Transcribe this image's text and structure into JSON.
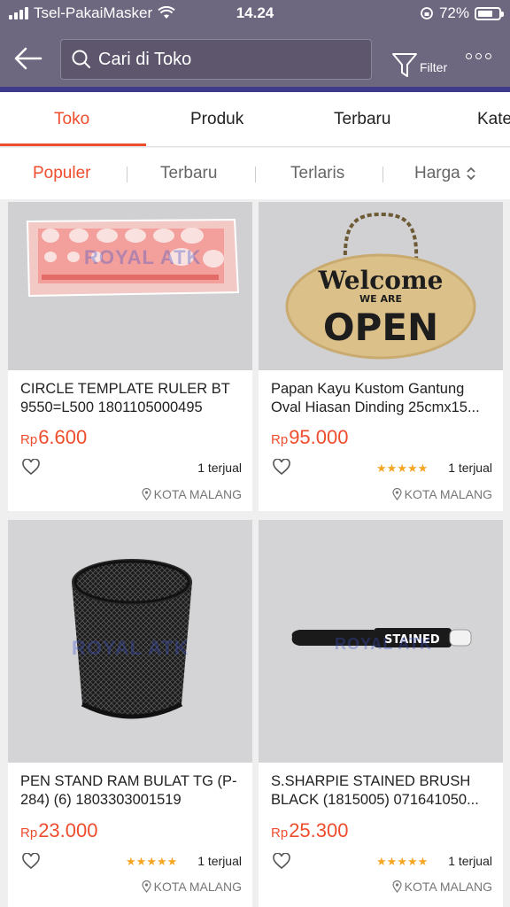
{
  "status": {
    "carrier": "Tsel-PakaiMasker",
    "time": "14.24",
    "battery": "72%",
    "battery_level": 0.72
  },
  "header": {
    "search_placeholder": "Cari di Toko",
    "filter_label": "Filter"
  },
  "tabs": [
    "Toko",
    "Produk",
    "Terbaru",
    "Kate"
  ],
  "sort": [
    "Populer",
    "Terbaru",
    "Terlaris",
    "Harga"
  ],
  "products": [
    {
      "name": "CIRCLE TEMPLATE RULER BT 9550=L500 1801105000495",
      "currency": "Rp",
      "price": "6.600",
      "rating": 0,
      "sold": "1 terjual",
      "location": "KOTA MALANG"
    },
    {
      "name": "Papan Kayu Kustom Gantung Oval Hiasan Dinding 25cmx15...",
      "currency": "Rp",
      "price": "95.000",
      "rating": 5,
      "sold": "1 terjual",
      "location": "KOTA MALANG",
      "sign_line1": "Welcome",
      "sign_line2": "WE ARE",
      "sign_line3": "OPEN"
    },
    {
      "name": "PEN STAND RAM BULAT TG (P-284) (6) 1803303001519",
      "currency": "Rp",
      "price": "23.000",
      "rating": 5,
      "sold": "1 terjual",
      "location": "KOTA MALANG"
    },
    {
      "name": "S.SHARPIE STAINED BRUSH BLACK (1815005) 071641050...",
      "currency": "Rp",
      "price": "25.300",
      "rating": 5,
      "sold": "1 terjual",
      "location": "KOTA MALANG",
      "marker_label": "STAINED"
    }
  ],
  "watermark": "ROYAL ATK",
  "colors": {
    "accent": "#ee4d2d",
    "header": "#6e6780",
    "star": "#f5a623"
  }
}
